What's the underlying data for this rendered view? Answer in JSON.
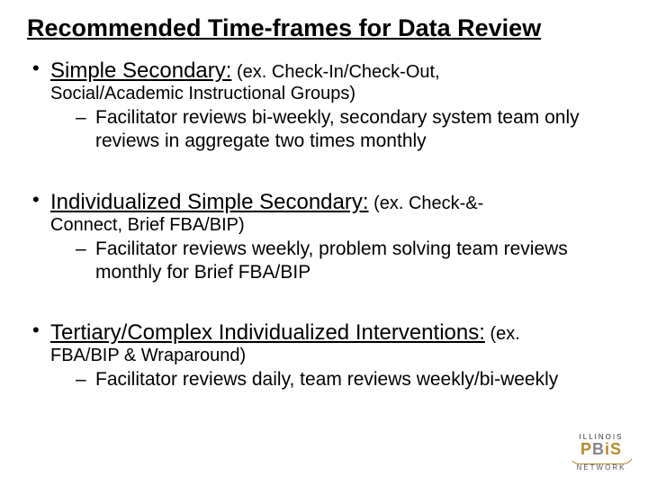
{
  "title": "Recommended Time-frames for Data Review",
  "items": [
    {
      "lead": "Simple Secondary:",
      "paren_start": " (ex. Check-In/Check-Out,",
      "cont": "Social/Academic Instructional Groups)",
      "sub": "Facilitator reviews bi-weekly, secondary system team only reviews in aggregate two times monthly"
    },
    {
      "lead": "Individualized Simple Secondary:",
      "paren_start": " (ex. Check-&-",
      "cont": "Connect, Brief FBA/BIP)",
      "sub": "Facilitator reviews weekly, problem solving team reviews monthly for Brief FBA/BIP"
    },
    {
      "lead": "Tertiary/Complex Individualized Interventions:",
      "paren_start": " (ex.",
      "cont": "FBA/BIP & Wraparound)",
      "sub": "Facilitator reviews daily, team reviews weekly/bi-weekly"
    }
  ],
  "logo": {
    "top": "ILLINOIS",
    "main_p": "P",
    "main_b": "B",
    "main_i": "i",
    "main_s": "S",
    "bottom": "NETWORK"
  }
}
